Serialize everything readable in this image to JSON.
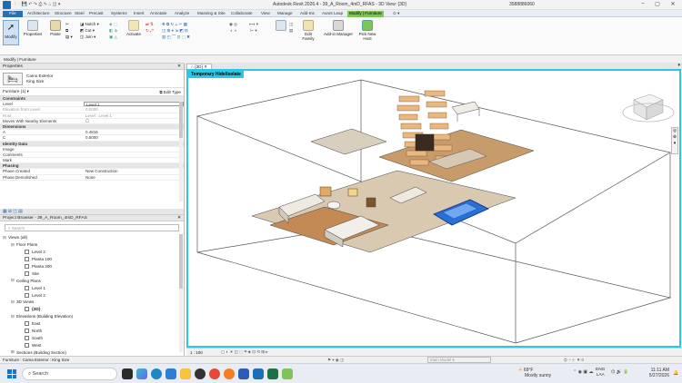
{
  "window": {
    "title": "Autodesk Revit 2026.4 - 39_A_Room_4mD_RFAS - 3D View: {3D}",
    "user": "3588886060"
  },
  "tabs": [
    "File",
    "Architecture",
    "Structure",
    "Steel",
    "Precast",
    "Systems",
    "Insert",
    "Annotate",
    "Analyze",
    "Massing & Site",
    "Collaborate",
    "View",
    "Manage",
    "Add-Ins",
    "Avant Leap",
    "Modify | Furniture"
  ],
  "ribbon": {
    "buttons": {
      "modify": "Modify",
      "properties": "Properties",
      "paste": "Paste",
      "cut": "Cut",
      "join": "Join",
      "activate": "Activate",
      "view": "View",
      "measure": "Measure",
      "create": "Create",
      "edit_family": "Edit Family",
      "addin_manager": "Add-in Manager",
      "pick_new_host": "Pick New Host",
      "match": "Match",
      "cope": "Cope"
    },
    "panels": [
      "Select ▾",
      "Properties",
      "Clipboard",
      "Geometry",
      "Controls",
      "Modify",
      "View",
      "Measure",
      "Create",
      "Mode",
      "External Tools",
      "Host"
    ]
  },
  "modify_bar": "Modify | Furniture",
  "properties": {
    "title": "Properties",
    "family": "Camo Exterior",
    "type": "King Size",
    "selector": "Furniture (1)",
    "edit_type": "Edit Type",
    "rows": [
      {
        "k": "Constraints",
        "v": "",
        "grp": true
      },
      {
        "k": "Level",
        "v": "Level 1"
      },
      {
        "k": "Elevation from Level",
        "v": "0.0000",
        "dim": true
      },
      {
        "k": "Host",
        "v": "Level : Level 1",
        "dim": true
      },
      {
        "k": "Moves With Nearby Elements",
        "v": "☐"
      },
      {
        "k": "Dimensions",
        "v": "",
        "grp": true
      },
      {
        "k": "A",
        "v": "0.4816"
      },
      {
        "k": "C",
        "v": "0.5000"
      },
      {
        "k": "Identity Data",
        "v": "",
        "grp": true
      },
      {
        "k": "Image",
        "v": ""
      },
      {
        "k": "Comments",
        "v": ""
      },
      {
        "k": "Mark",
        "v": ""
      },
      {
        "k": "Phasing",
        "v": "",
        "grp": true
      },
      {
        "k": "Phase Created",
        "v": "New Construction"
      },
      {
        "k": "Phase Demolished",
        "v": "None"
      }
    ]
  },
  "browser": {
    "title": "Project Browser - 39_A_Room_4mD_RFAS",
    "search": "Search",
    "items": [
      {
        "label": "Views (all)",
        "lvl": 0,
        "tg": "⊟",
        "box": false
      },
      {
        "label": "Floor Plans",
        "lvl": 1,
        "tg": "⊟",
        "box": false
      },
      {
        "label": "Level 2",
        "lvl": 2,
        "tg": "",
        "box": true
      },
      {
        "label": "Planta 100",
        "lvl": 2,
        "tg": "",
        "box": true
      },
      {
        "label": "Planta 300",
        "lvl": 2,
        "tg": "",
        "box": true
      },
      {
        "label": "Site",
        "lvl": 2,
        "tg": "",
        "box": true
      },
      {
        "label": "Ceiling Plans",
        "lvl": 1,
        "tg": "⊟",
        "box": false
      },
      {
        "label": "Level 1",
        "lvl": 2,
        "tg": "",
        "box": true
      },
      {
        "label": "Level 2",
        "lvl": 2,
        "tg": "",
        "box": true
      },
      {
        "label": "3D Views",
        "lvl": 1,
        "tg": "⊟",
        "box": false
      },
      {
        "label": "{3D}",
        "lvl": 2,
        "tg": "",
        "box": true,
        "bold": true
      },
      {
        "label": "Elevations (Building Elevation)",
        "lvl": 1,
        "tg": "⊟",
        "box": false
      },
      {
        "label": "East",
        "lvl": 2,
        "tg": "",
        "box": true
      },
      {
        "label": "North",
        "lvl": 2,
        "tg": "",
        "box": true
      },
      {
        "label": "South",
        "lvl": 2,
        "tg": "",
        "box": true
      },
      {
        "label": "West",
        "lvl": 2,
        "tg": "",
        "box": true
      },
      {
        "label": "Sections (Building Section)",
        "lvl": 1,
        "tg": "⊞",
        "box": false
      }
    ]
  },
  "view": {
    "tab": "{3D}",
    "banner": "Temporary Hide/Isolate",
    "scale": "1 : 100"
  },
  "status": {
    "text": "Furniture : Cama Exterior : King Size",
    "model": "Main Model"
  },
  "taskbar": {
    "search": "Search",
    "weather_temp": "69°F",
    "weather_text": "Mostly sunny",
    "lang": "ENG",
    "region": "LAA",
    "time": "11:11 AM",
    "date": "5/27/2026"
  },
  "colors": {
    "accent": "#2bc8e6",
    "file_tab": "#2a6fb2",
    "context_tab": "#7ec456",
    "wood": "#e8b880",
    "floor": "#c89b6a",
    "pool": "#2a6fd8"
  }
}
